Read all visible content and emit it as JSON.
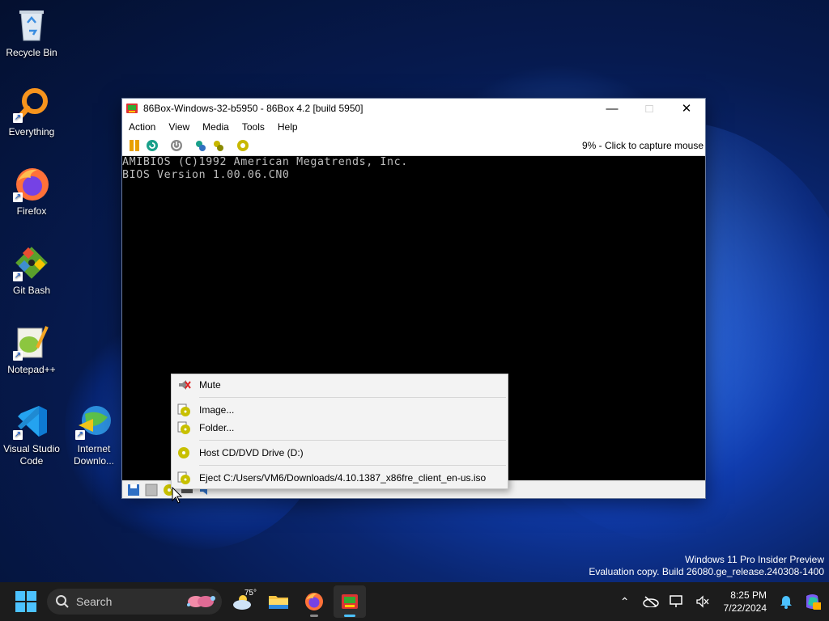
{
  "desktop": {
    "icons": [
      {
        "label": "Recycle Bin"
      },
      {
        "label": "Everything"
      },
      {
        "label": "Firefox"
      },
      {
        "label": "Git Bash"
      },
      {
        "label": "Notepad++"
      },
      {
        "label": "Visual Studio Code"
      },
      {
        "label": "Internet Downlo..."
      }
    ]
  },
  "window": {
    "title": "86Box-Windows-32-b5950 - 86Box 4.2 [build 5950]",
    "menu": [
      "Action",
      "View",
      "Media",
      "Tools",
      "Help"
    ],
    "toolbar_status": "9% - Click to capture mouse",
    "screen_lines": [
      "AMIBIOS (C)1992 American Megatrends, Inc.",
      "BIOS Version 1.00.06.CN0"
    ]
  },
  "context_menu": {
    "items": [
      {
        "label": "Mute"
      },
      {
        "label": "Image..."
      },
      {
        "label": "Folder..."
      },
      {
        "label": "Host CD/DVD Drive (D:)"
      },
      {
        "label": "Eject C:/Users/VM6/Downloads/4.10.1387_x86fre_client_en-us.iso"
      }
    ]
  },
  "watermark": {
    "line1": "Windows 11 Pro Insider Preview",
    "line2": "Evaluation copy. Build 26080.ge_release.240308-1400"
  },
  "taskbar": {
    "search_placeholder": "Search",
    "weather_temp": "75°",
    "time": "8:25 PM",
    "date": "7/22/2024",
    "accent": "#4cc2ff"
  }
}
